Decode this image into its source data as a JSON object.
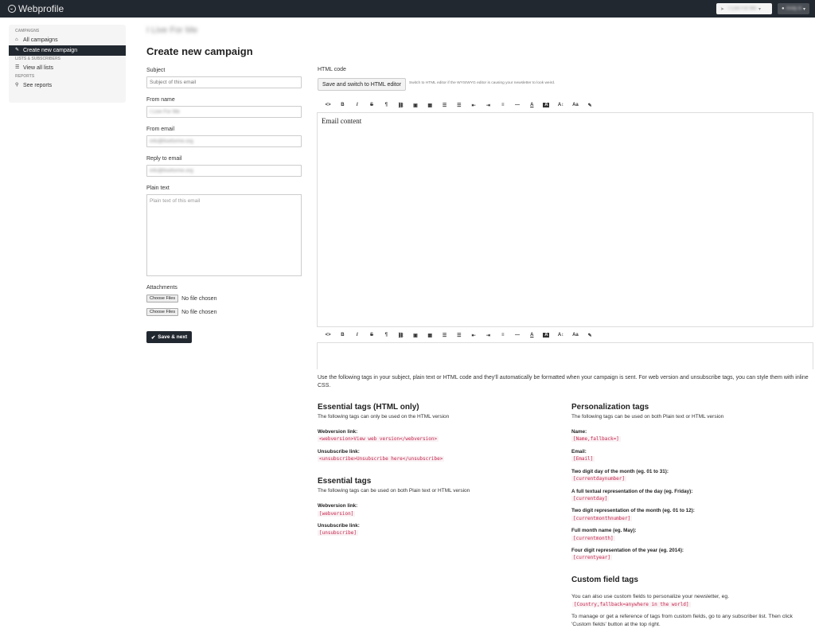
{
  "navbar": {
    "brand": "Webprofile",
    "brand_switch": "I Live For Me",
    "user": "Andy B"
  },
  "sidebar": {
    "sections": [
      {
        "header": "Campaigns",
        "items": [
          {
            "label": "All campaigns",
            "icon": "home-icon",
            "active": false
          },
          {
            "label": "Create new campaign",
            "icon": "edit-icon",
            "active": true
          }
        ]
      },
      {
        "header": "Lists & subscribers",
        "items": [
          {
            "label": "View all lists",
            "icon": "list-icon",
            "active": false
          }
        ]
      },
      {
        "header": "Reports",
        "items": [
          {
            "label": "See reports",
            "icon": "search-icon",
            "active": false
          }
        ]
      }
    ]
  },
  "page": {
    "brand_name": "I Live For Me",
    "title": "Create new campaign"
  },
  "form": {
    "subject_label": "Subject",
    "subject_placeholder": "Subject of this email",
    "from_name_label": "From name",
    "from_name_value": "I Live For Me",
    "from_email_label": "From email",
    "from_email_value": "info@liveforme.org",
    "reply_to_label": "Reply to email",
    "reply_to_value": "info@liveforme.org",
    "plain_text_label": "Plain text",
    "plain_text_placeholder": "Plain text of this email",
    "attachments_label": "Attachments",
    "choose_files": "Choose Files",
    "no_file": "No file chosen",
    "save_next": "Save & next"
  },
  "editor": {
    "html_label": "HTML code",
    "switch_button": "Save and switch to HTML editor",
    "switch_hint": "Switch to HTML editor if the WYSIWYG editor is causing your newsletter to look weird.",
    "content": "Email content",
    "toolbar": [
      {
        "name": "code-view-icon",
        "glyph": "<>"
      },
      {
        "name": "bold-icon",
        "glyph": "B"
      },
      {
        "name": "italic-icon",
        "glyph": "I"
      },
      {
        "name": "strikethrough-icon",
        "glyph": "S"
      },
      {
        "name": "paragraph-icon",
        "glyph": "¶"
      },
      {
        "name": "link-icon",
        "glyph": "⛓"
      },
      {
        "name": "image-icon",
        "glyph": "▣"
      },
      {
        "name": "table-icon",
        "glyph": "▦"
      },
      {
        "name": "unordered-list-icon",
        "glyph": "☰"
      },
      {
        "name": "ordered-list-icon",
        "glyph": "☰"
      },
      {
        "name": "outdent-icon",
        "glyph": "⇤"
      },
      {
        "name": "indent-icon",
        "glyph": "⇥"
      },
      {
        "name": "align-icon",
        "glyph": "≡"
      },
      {
        "name": "horizontal-rule-icon",
        "glyph": "—"
      },
      {
        "name": "font-color-icon",
        "glyph": "A"
      },
      {
        "name": "background-color-icon",
        "glyph": "A"
      },
      {
        "name": "font-size-icon",
        "glyph": "A↕"
      },
      {
        "name": "font-family-icon",
        "glyph": "Aa"
      },
      {
        "name": "format-icon",
        "glyph": "✎"
      }
    ]
  },
  "help": {
    "intro": "Use the following tags in your subject, plain text or HTML code and they'll automatically be formatted when your campaign is sent. For web version and unsubscribe tags, you can style them with inline CSS.",
    "essential_html": {
      "title": "Essential tags (HTML only)",
      "desc": "The following tags can only be used on the HTML version",
      "tags": [
        {
          "label": "Webversion link:",
          "code": "<webversion>View web version</webversion>"
        },
        {
          "label": "Unsubscribe link:",
          "code": "<unsubscribe>Unsubscribe here</unsubscribe>"
        }
      ]
    },
    "essential": {
      "title": "Essential tags",
      "desc": "The following tags can be used on both Plain text or HTML version",
      "tags": [
        {
          "label": "Webversion link:",
          "code": "[webversion]"
        },
        {
          "label": "Unsubscribe link:",
          "code": "[unsubscribe]"
        }
      ]
    },
    "personalization": {
      "title": "Personalization tags",
      "desc": "The following tags can be used on both Plain text or HTML version",
      "tags": [
        {
          "label": "Name:",
          "code": "[Name,fallback=]"
        },
        {
          "label": "Email:",
          "code": "[Email]"
        },
        {
          "label": "Two digit day of the month (eg. 01 to 31):",
          "code": "[currentdaynumber]"
        },
        {
          "label": "A full textual representation of the day (eg. Friday):",
          "code": "[currentday]"
        },
        {
          "label": "Two digit representation of the month (eg. 01 to 12):",
          "code": "[currentmonthnumber]"
        },
        {
          "label": "Full month name (eg. May):",
          "code": "[currentmonth]"
        },
        {
          "label": "Four digit representation of the year (eg. 2014):",
          "code": "[currentyear]"
        }
      ]
    },
    "custom": {
      "title": "Custom field tags",
      "desc": "You can also use custom fields to personalize your newsletter, eg.",
      "example": "[Country,fallback=anywhere in the world]",
      "note": "To manage or get a reference of tags from custom fields, go to any subscriber list. Then click 'Custom fields' button at the top right."
    }
  }
}
